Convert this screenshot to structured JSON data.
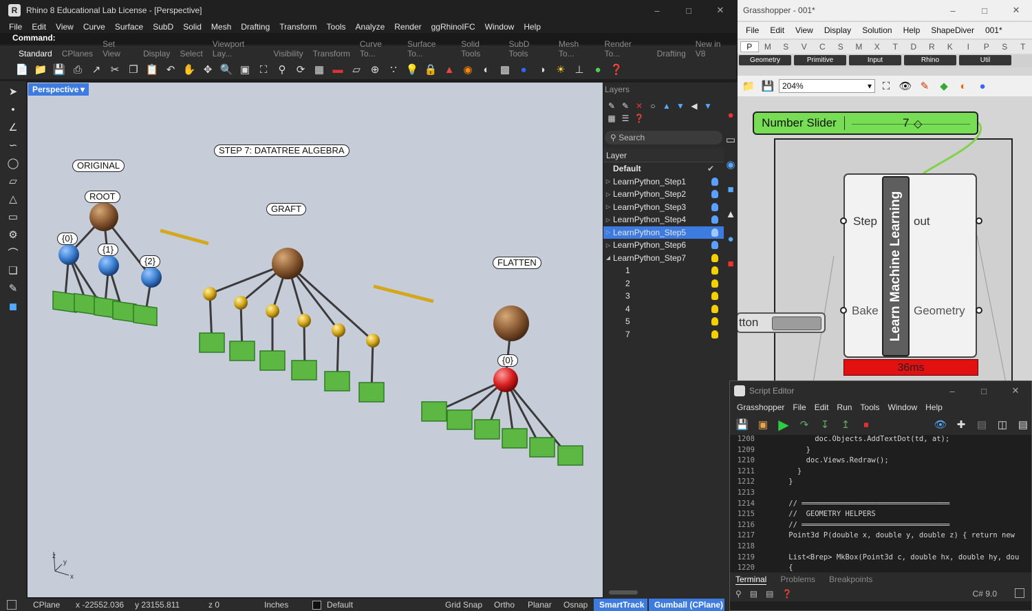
{
  "rhino": {
    "title": "Rhino 8 Educational Lab License - [Perspective]",
    "menu": [
      "File",
      "Edit",
      "View",
      "Curve",
      "Surface",
      "SubD",
      "Solid",
      "Mesh",
      "Drafting",
      "Transform",
      "Tools",
      "Analyze",
      "Render",
      "ggRhinoIFC",
      "Window",
      "Help"
    ],
    "command": "Command:",
    "tabs": [
      "Standard",
      "CPlanes",
      "Set View",
      "Display",
      "Select",
      "Viewport Lay...",
      "Visibility",
      "Transform",
      "Curve To...",
      "Surface To...",
      "Solid Tools",
      "SubD Tools",
      "Mesh To...",
      "Render To...",
      "Drafting",
      "New in V8"
    ],
    "viewport_name": "Perspective",
    "labels": {
      "original": "ORIGINAL",
      "root": "ROOT",
      "b0": "{0}",
      "b1": "{1}",
      "b2": "{2}",
      "step": "STEP 7: DATATREE ALGEBRA",
      "graft": "GRAFT",
      "flatten": "FLATTEN",
      "fb0": "{0}"
    },
    "axes": {
      "x": "x",
      "y": "y",
      "z": "z"
    }
  },
  "layers": {
    "header": "Layers",
    "search_placeholder": "Search",
    "column": "Layer",
    "items": [
      {
        "name": "Default",
        "bold": true,
        "color": "check"
      },
      {
        "name": "LearnPython_Step1",
        "color": "#5aa0ff"
      },
      {
        "name": "LearnPython_Step2",
        "color": "#5aa0ff"
      },
      {
        "name": "LearnPython_Step3",
        "color": "#5aa0ff"
      },
      {
        "name": "LearnPython_Step4",
        "color": "#5aa0ff"
      },
      {
        "name": "LearnPython_Step5",
        "color": "#9ec8ff",
        "selected": true
      },
      {
        "name": "LearnPython_Step6",
        "color": "#5aa0ff"
      },
      {
        "name": "LearnPython_Step7",
        "color": "#f5d000",
        "expanded": true
      },
      {
        "name": "1",
        "color": "#f5d000",
        "child": true
      },
      {
        "name": "2",
        "color": "#f5d000",
        "child": true
      },
      {
        "name": "3",
        "color": "#f5d000",
        "child": true
      },
      {
        "name": "4",
        "color": "#f5d000",
        "child": true
      },
      {
        "name": "5",
        "color": "#f5d000",
        "child": true
      },
      {
        "name": "7",
        "color": "#f5d000",
        "child": true
      }
    ]
  },
  "status": {
    "cplane": "CPlane",
    "x": "x -22552.036",
    "y": "y 23155.811",
    "z": "z 0",
    "units": "Inches",
    "layer": "Default",
    "grid_snap": "Grid Snap",
    "ortho": "Ortho",
    "planar": "Planar",
    "osnap": "Osnap",
    "smarttrack": "SmartTrack",
    "gumball": "Gumball (CPlane)"
  },
  "grasshopper": {
    "title": "Grasshopper - 001*",
    "menu": [
      "File",
      "Edit",
      "View",
      "Display",
      "Solution",
      "Help",
      "ShapeDiver",
      "001*"
    ],
    "tabs": [
      "P",
      "M",
      "S",
      "V",
      "C",
      "S",
      "M",
      "X",
      "T",
      "D",
      "R",
      "K",
      "I",
      "P",
      "S",
      "T"
    ],
    "categories": [
      "Geometry",
      "Primitive",
      "Input",
      "Rhino",
      "Util"
    ],
    "zoom": "204%",
    "slider_label": "Number Slider",
    "slider_value": "7",
    "component_name": "Learn Machine Learning",
    "inputs": [
      "Step",
      "Bake"
    ],
    "outputs": [
      "out",
      "Geometry"
    ],
    "button_label": "tton",
    "timing": "36ms"
  },
  "script_editor": {
    "title": "Script Editor",
    "menu": [
      "Grasshopper",
      "File",
      "Edit",
      "Run",
      "Tools",
      "Window",
      "Help"
    ],
    "tabs": [
      "Terminal",
      "Problems",
      "Breakpoints"
    ],
    "language": "C# 9.0",
    "lines": [
      {
        "n": "1208",
        "indent": "          ",
        "t": "doc.Objects.AddTextDot(td, at);"
      },
      {
        "n": "1209",
        "indent": "        ",
        "t": "}"
      },
      {
        "n": "1210",
        "indent": "        ",
        "t": "doc.Views.Redraw();"
      },
      {
        "n": "1211",
        "indent": "      ",
        "t": "}"
      },
      {
        "n": "1212",
        "indent": "    ",
        "t": "}"
      },
      {
        "n": "1213",
        "indent": "",
        "t": ""
      },
      {
        "n": "1214",
        "indent": "    ",
        "t": "// ══════════════════════════════════"
      },
      {
        "n": "1215",
        "indent": "    ",
        "t": "//  GEOMETRY HELPERS"
      },
      {
        "n": "1216",
        "indent": "    ",
        "t": "// ══════════════════════════════════"
      },
      {
        "n": "1217",
        "indent": "    ",
        "t": "Point3d P(double x, double y, double z) { return new"
      },
      {
        "n": "1218",
        "indent": "",
        "t": ""
      },
      {
        "n": "1219",
        "indent": "    ",
        "t": "List<Brep> MkBox(Point3d c, double hx, double hy, dou"
      },
      {
        "n": "1220",
        "indent": "    ",
        "t": "{"
      }
    ]
  }
}
